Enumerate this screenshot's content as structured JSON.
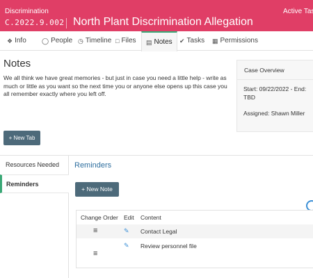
{
  "header": {
    "case_type": "Discrimination",
    "case_id": "C.2022.9.002",
    "title": "North Plant Discrimination Allegation",
    "right_text": "Active Tas"
  },
  "tabs": [
    {
      "label": "Info",
      "icon": "info-icon"
    },
    {
      "label": "People",
      "icon": "people-icon"
    },
    {
      "label": "Timeline",
      "icon": "clock-icon"
    },
    {
      "label": "Files",
      "icon": "file-icon"
    },
    {
      "label": "Notes",
      "icon": "notes-icon",
      "active": true
    },
    {
      "label": "Tasks",
      "icon": "check-icon"
    },
    {
      "label": "Permissions",
      "icon": "lock-icon"
    }
  ],
  "notes": {
    "title": "Notes",
    "description": "We all think we have great memories - but just in case you need a little help - write as much or little as you want so the next time you or anyone else opens up this case you all remember exactly where you left off.",
    "new_tab_label": "+ New Tab"
  },
  "overview": {
    "heading": "Case Overview",
    "dates": "Start: 09/22/2022 - End: TBD",
    "assigned": "Assigned: Shawn Miller"
  },
  "sidebar": {
    "items": [
      {
        "label": "Resources Needed"
      },
      {
        "label": "Reminders",
        "active": true
      }
    ]
  },
  "reminders": {
    "title": "Reminders",
    "new_note_label": "+ New Note",
    "columns": [
      "Change Order",
      "Edit",
      "Content"
    ],
    "rows": [
      {
        "content": "Contact Legal"
      },
      {
        "content": "Review personnel file"
      }
    ]
  },
  "colors": {
    "header_bg": "#e03e66",
    "accent_green": "#3aa876",
    "button_bg": "#4d6a7a",
    "link_blue": "#2d6e9e"
  }
}
